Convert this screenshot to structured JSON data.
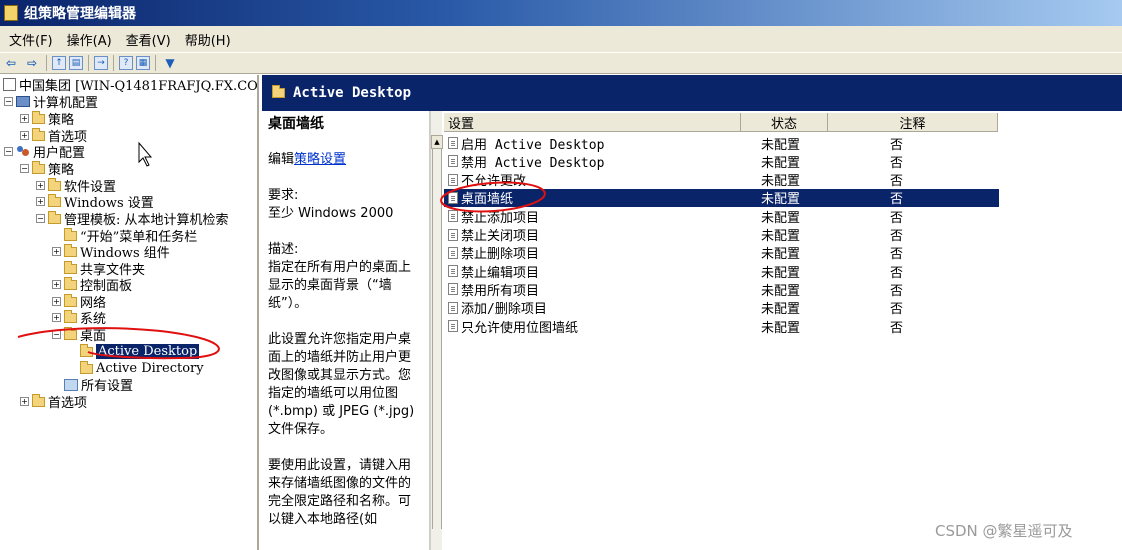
{
  "window": {
    "title": "组策略管理编辑器"
  },
  "menu": [
    "文件(F)",
    "操作(A)",
    "查看(V)",
    "帮助(H)"
  ],
  "tree": {
    "root": "中国集团 [WIN-Q1481FRAFJQ.FX.CO",
    "computer_config": "计算机配置",
    "cc_policies": "策略",
    "cc_prefs": "首选项",
    "user_config": "用户配置",
    "uc_policies": "策略",
    "software_settings": "软件设置",
    "windows_settings": "Windows 设置",
    "admin_templates": "管理模板: 从本地计算机检索",
    "start_menu": "“开始”菜单和任务栏",
    "windows_components": "Windows 组件",
    "shared_folders": "共享文件夹",
    "control_panel": "控制面板",
    "network": "网络",
    "system": "系统",
    "desktop": "桌面",
    "active_desktop": "Active Desktop",
    "active_directory": "Active Directory",
    "all_settings": "所有设置",
    "uc_prefs": "首选项"
  },
  "header": {
    "title": "Active Desktop"
  },
  "description": {
    "title": "桌面墙纸",
    "edit_prefix": "编辑",
    "edit_link": "策略设置",
    "requirements_label": "要求:",
    "requirements": "至少 Windows 2000",
    "desc_label": "描述:",
    "desc_1": "指定在所有用户的桌面上显示的桌面背景（“墙纸”）。",
    "desc_2": "此设置允许您指定用户桌面上的墙纸并防止用户更改图像或其显示方式。您指定的墙纸可以用位图 (*.bmp) 或 JPEG (*.jpg) 文件保存。",
    "desc_3": "要使用此设置，请键入用来存储墙纸图像的文件的完全限定路径和名称。可以键入本地路径(如"
  },
  "columns": {
    "setting": "设置",
    "state": "状态",
    "comment": "注释"
  },
  "settings": [
    {
      "name": "启用 Active Desktop",
      "state": "未配置",
      "comment": "否"
    },
    {
      "name": "禁用 Active Desktop",
      "state": "未配置",
      "comment": "否"
    },
    {
      "name": "不允许更改",
      "state": "未配置",
      "comment": "否"
    },
    {
      "name": "桌面墙纸",
      "state": "未配置",
      "comment": "否"
    },
    {
      "name": "禁止添加项目",
      "state": "未配置",
      "comment": "否"
    },
    {
      "name": "禁止关闭项目",
      "state": "未配置",
      "comment": "否"
    },
    {
      "name": "禁止删除项目",
      "state": "未配置",
      "comment": "否"
    },
    {
      "name": "禁止编辑项目",
      "state": "未配置",
      "comment": "否"
    },
    {
      "name": "禁用所有项目",
      "state": "未配置",
      "comment": "否"
    },
    {
      "name": "添加/删除项目",
      "state": "未配置",
      "comment": "否"
    },
    {
      "name": "只允许使用位图墙纸",
      "state": "未配置",
      "comment": "否"
    }
  ],
  "watermark": "CSDN @繁星遥可及",
  "colors": {
    "selection": "#0a246a",
    "annotation": "#e01010"
  }
}
